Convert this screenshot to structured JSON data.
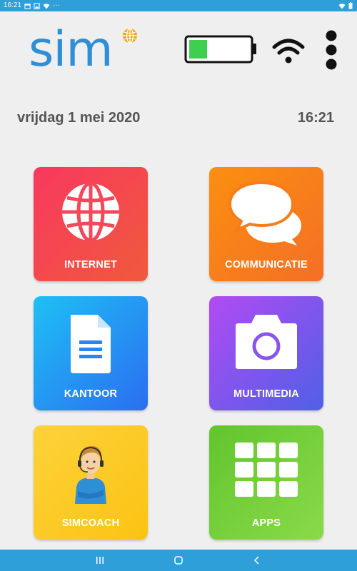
{
  "status_bar": {
    "time": "16:21",
    "left_icons": [
      "calendar-icon",
      "image-icon",
      "wifi-icon",
      "more-icon"
    ],
    "right_icons": [
      "wifi-icon",
      "battery-icon"
    ],
    "overflow": "···"
  },
  "header": {
    "logo_text": "sim",
    "battery_icon": "battery-icon",
    "battery_level_fraction": 0.3,
    "battery_fill_color": "#3ecf4e",
    "wifi_icon": "wifi-icon",
    "menu_icon": "more-vertical-icon"
  },
  "date_line": {
    "date": "vrijdag 1 mei 2020",
    "time": "16:21"
  },
  "tiles": [
    {
      "label": "INTERNET",
      "icon": "globe-icon",
      "color_start": "#f8385f",
      "color_end": "#f05a3c"
    },
    {
      "label": "COMMUNICATIE",
      "icon": "chat-bubbles-icon",
      "color_start": "#fb8f0f",
      "color_end": "#f46f26"
    },
    {
      "label": "KANTOOR",
      "icon": "document-icon",
      "color_start": "#1ec0f5",
      "color_end": "#2b6ef0"
    },
    {
      "label": "MULTIMEDIA",
      "icon": "camera-icon",
      "color_start": "#b24bf3",
      "color_end": "#4f60e6"
    },
    {
      "label": "SIMCOACH",
      "icon": "coach-avatar-icon",
      "color_start": "#fed23a",
      "color_end": "#fbc313"
    },
    {
      "label": "APPS",
      "icon": "apps-grid-icon",
      "color_start": "#61c52d",
      "color_end": "#8ada49"
    }
  ],
  "nav_bar": {
    "recent_icon": "recent-apps-icon",
    "home_icon": "home-icon",
    "back_icon": "back-icon"
  },
  "colors": {
    "status_bar": "#2e9fd8",
    "background": "#efefef",
    "logo_blue": "#2f8fd6",
    "text_gray": "#555555"
  }
}
